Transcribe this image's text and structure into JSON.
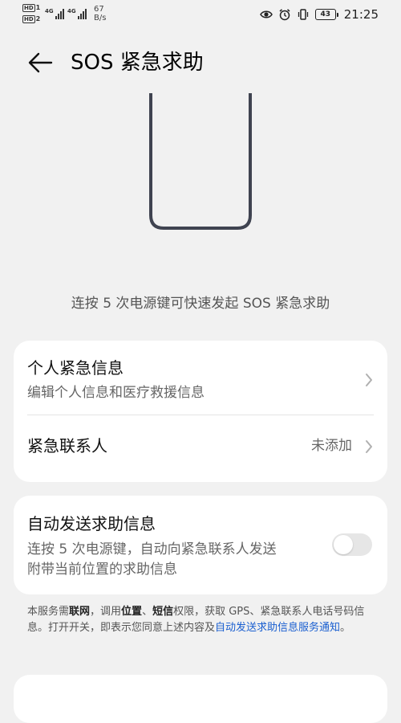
{
  "status_bar": {
    "sim1": "HD",
    "sim1_slot": "1",
    "sim2": "HD",
    "sim2_slot": "2",
    "net1": "4G",
    "net2": "4G",
    "speed_value": "67",
    "speed_unit": "B/s",
    "battery": "43",
    "time": "21:25",
    "icons": [
      "eye-icon",
      "alarm-icon",
      "vibrate-icon",
      "battery-icon"
    ]
  },
  "header": {
    "back_icon": "arrow-left-icon",
    "title": "SOS 紧急求助"
  },
  "illustration": {
    "icon": "phone-outline-icon"
  },
  "hint": "连按 5 次电源键可快速发起 SOS 紧急求助",
  "card_1": {
    "personal_info": {
      "title": "个人紧急信息",
      "subtitle": "编辑个人信息和医疗救援信息"
    },
    "contacts": {
      "title": "紧急联系人",
      "value": "未添加"
    }
  },
  "card_2": {
    "auto_send": {
      "title": "自动发送求助信息",
      "subtitle_line1": "连按 5 次电源键，自动向紧急联系人发送",
      "subtitle_line2": "附带当前位置的求助信息",
      "enabled": false
    }
  },
  "notice": {
    "p1": "本服务需",
    "em1": "联网",
    "p2": "，调用",
    "em2": "位置",
    "p3": "、",
    "em3": "短信",
    "p4": "权限，获取 GPS、紧急联系人电话号码信息。打开开关，即表示您同意上述内容及",
    "link": "自动发送求助信息服务通知",
    "p5": "。"
  },
  "colors": {
    "background": "#f1f1f1",
    "card": "#ffffff",
    "link": "#1a5fd0",
    "illustration_stroke": "#3f4350"
  }
}
